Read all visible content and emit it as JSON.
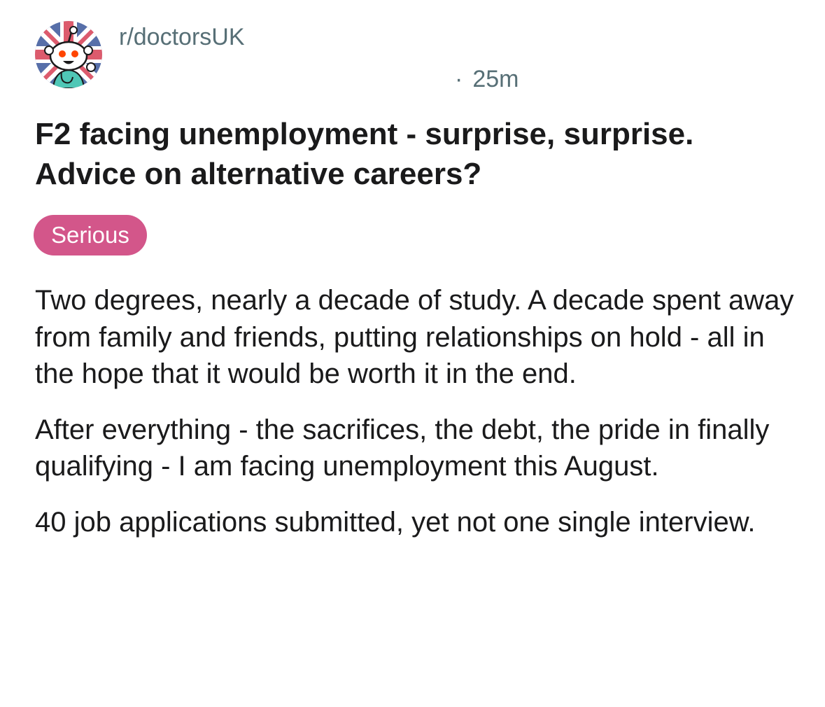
{
  "post": {
    "subreddit": "r/doctorsUK",
    "separator": "·",
    "time_ago": "25m",
    "title_line1": "F2 facing unemployment - surprise, surprise.",
    "title_line2": "Advice on alternative careers?",
    "flair": "Serious",
    "paragraphs": [
      "Two degrees, nearly a decade of study. A decade spent away from family and friends, putting relationships on hold - all in the hope that it would be worth it in the end.",
      "After everything - the sacrifices, the debt, the pride in finally qualifying - I am facing unemployment this August.",
      "40 job applications submitted, yet not one single interview."
    ]
  },
  "colors": {
    "meta_text": "#576f76",
    "body_text": "#1a1a1b",
    "flair_background": "#d3568a",
    "flair_text": "#ffffff",
    "uk_flag_blue": "#1f3f8c",
    "uk_flag_red": "#d0243c",
    "snoo_orange": "#ff4500",
    "scrubs_teal": "#4fc7b6"
  },
  "icons": {
    "avatar": "subreddit-avatar-snoo-doctor-union-jack"
  }
}
